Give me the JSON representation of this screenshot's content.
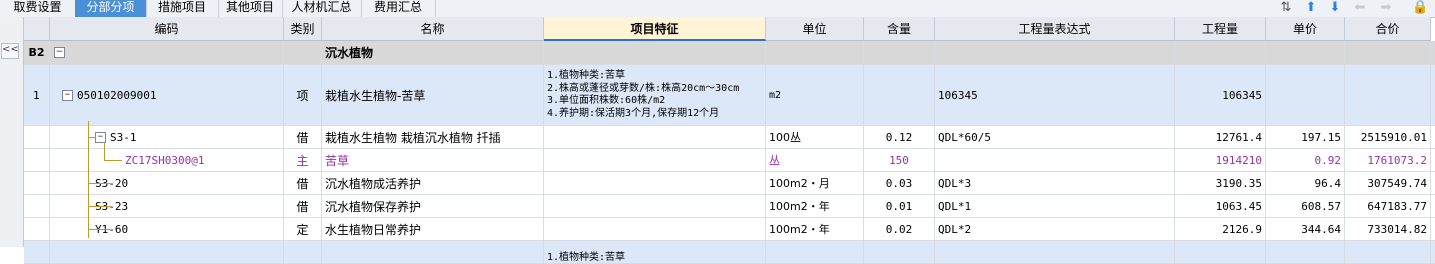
{
  "tabs": [
    "取费设置",
    "分部分项",
    "措施项目",
    "其他项目",
    "人材机汇总",
    "费用汇总"
  ],
  "active_tab": 1,
  "toolbar_icons": [
    "sort-icon",
    "arrow-up-icon",
    "arrow-down-icon",
    "arrow-left-icon",
    "arrow-right-icon",
    "lock-icon"
  ],
  "collapse_label": "<<",
  "columns": [
    "",
    "编码",
    "类别",
    "名称",
    "项目特征",
    "单位",
    "含量",
    "工程量表达式",
    "工程量",
    "单价",
    "合价"
  ],
  "section": {
    "index": "B2",
    "name": "沉水植物"
  },
  "item": {
    "index": "1",
    "code": "050102009001",
    "type": "项",
    "name": "栽植水生植物-苦草",
    "features": [
      "1.植物种类:苦草",
      "2.株高或蓬径或芽数/株:株高20cm～30cm",
      "3.单位面积株数:60株/m2",
      "4.养护期:保活期3个月,保存期12个月"
    ],
    "unit": "m2",
    "expr": "106345",
    "qty": "106345"
  },
  "rows": [
    {
      "code": "S3-1",
      "type": "借",
      "name": "栽植水生植物 栽植沉水植物 扦插",
      "unit": "100丛",
      "content": "0.12",
      "expr": "QDL*60/5",
      "qty": "12761.4",
      "price": "197.15",
      "total": "2515910.01",
      "level": 1,
      "expand": true,
      "color": "#000000"
    },
    {
      "code": "ZC17SH0300@1",
      "type": "主",
      "name": "苦草",
      "unit": "丛",
      "content": "150",
      "expr": "",
      "qty": "1914210",
      "price": "0.92",
      "total": "1761073.2",
      "level": 2,
      "expand": false,
      "color": "#9a2fa8"
    },
    {
      "code": "S3-20",
      "type": "借",
      "name": "沉水植物成活养护",
      "unit": "100m2・月",
      "content": "0.03",
      "expr": "QDL*3",
      "qty": "3190.35",
      "price": "96.4",
      "total": "307549.74",
      "level": 1,
      "expand": false,
      "color": "#000000"
    },
    {
      "code": "S3-23",
      "type": "借",
      "name": "沉水植物保存养护",
      "unit": "100m2・年",
      "content": "0.01",
      "expr": "QDL*1",
      "qty": "1063.45",
      "price": "608.57",
      "total": "647183.77",
      "level": 1,
      "expand": false,
      "color": "#000000"
    },
    {
      "code": "Y1-60",
      "type": "定",
      "name": "水生植物日常养护",
      "unit": "100m2・年",
      "content": "0.02",
      "expr": "QDL*2",
      "qty": "2126.9",
      "price": "344.64",
      "total": "733014.82",
      "level": 1,
      "expand": false,
      "color": "#000000"
    }
  ],
  "partial_row_feature": "1.植物种类:苦草"
}
